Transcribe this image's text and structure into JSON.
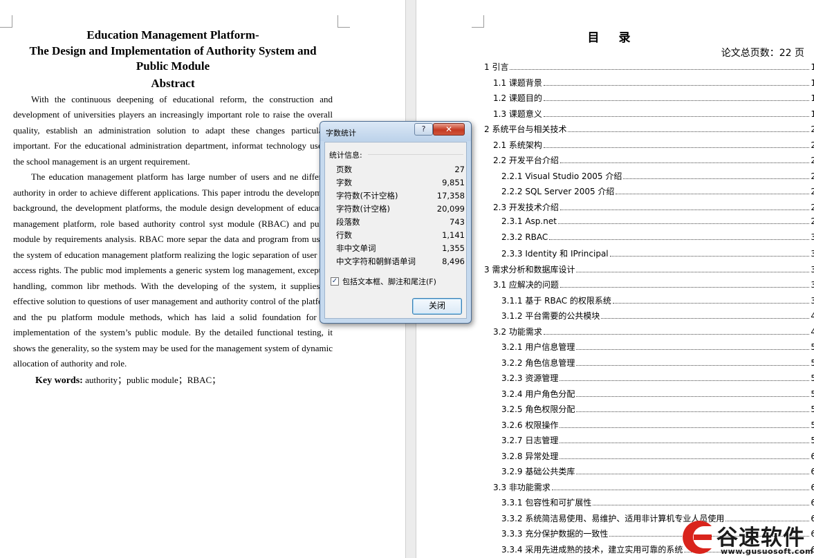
{
  "left_page": {
    "title_lines": [
      "Education Management Platform-",
      "The Design and Implementation of Authority System and",
      "Public Module"
    ],
    "abstract_heading": "Abstract",
    "para1": "With the continuous deepening of educational reform, the construction and development of universities players an increasingly important role to raise the overall quality, establish an administration solution to adapt these changes particularly important. For the educational administration department, informat technology use in the school management is an urgent requirement.",
    "para2": "The education management platform has large number of users and ne different authority in order to achieve different applications. This paper introdu the development background, the development platforms, the module design development of education management platform, role based authority control syst module (RBAC) and public module by requirements analysis. RBAC more separ the data and program from users, the system of education management platform realizing the logic separation of user and access rights. The public mod implements a generic system log management, exception handling, common libr methods. With the developing of the system, it supplies an effective solution to questions of user management and authority control of the platform and the pu platform module methods, which has laid a solid foundation for the implementation of the system’s public module. By the detailed functional testing, it shows the generality, so the system may be used for the management system of dynamic allocation of authority and role.",
    "keywords_label": "Key words:",
    "keywords_value": "authority；public module；RBAC；"
  },
  "right_page": {
    "toc_title": "目录",
    "total_pages": "论文总页数：22 页",
    "toc": [
      {
        "label": "1 引言",
        "page": "1",
        "level": 1
      },
      {
        "label": "1.1 课题背景",
        "page": "1",
        "level": 2
      },
      {
        "label": "1.2 课题目的",
        "page": "1",
        "level": 2
      },
      {
        "label": "1.3 课题意义",
        "page": "1",
        "level": 2
      },
      {
        "label": "2 系统平台与相关技术",
        "page": "2",
        "level": 1
      },
      {
        "label": "2.1 系统架构",
        "page": "2",
        "level": 2
      },
      {
        "label": "2.2 开发平台介绍",
        "page": "2",
        "level": 2
      },
      {
        "label": "2.2.1 Visual Studio 2005 介绍",
        "page": "2",
        "level": 3
      },
      {
        "label": "2.2.2 SQL Server 2005 介绍",
        "page": "2",
        "level": 3
      },
      {
        "label": "2.3 开发技术介绍",
        "page": "2",
        "level": 2
      },
      {
        "label": "2.3.1 Asp.net",
        "page": "2",
        "level": 3
      },
      {
        "label": "2.3.2 RBAC",
        "page": "3",
        "level": 3
      },
      {
        "label": "2.3.3 Identity 和 IPrincipal",
        "page": "3",
        "level": 3
      },
      {
        "label": "3 需求分析和数据库设计",
        "page": "3",
        "level": 1
      },
      {
        "label": "3.1 应解决的问题",
        "page": "3",
        "level": 2
      },
      {
        "label": "3.1.1 基于 RBAC 的权限系统",
        "page": "3",
        "level": 3
      },
      {
        "label": "3.1.2 平台需要的公共模块",
        "page": "4",
        "level": 3
      },
      {
        "label": "3.2 功能需求",
        "page": "4",
        "level": 2
      },
      {
        "label": "3.2.1 用户信息管理",
        "page": "5",
        "level": 3
      },
      {
        "label": "3.2.2 角色信息管理",
        "page": "5",
        "level": 3
      },
      {
        "label": "3.2.3 资源管理",
        "page": "5",
        "level": 3
      },
      {
        "label": "3.2.4 用户角色分配",
        "page": "5",
        "level": 3
      },
      {
        "label": "3.2.5 角色权限分配",
        "page": "5",
        "level": 3
      },
      {
        "label": "3.2.6 权限操作",
        "page": "5",
        "level": 3
      },
      {
        "label": "3.2.7 日志管理",
        "page": "5",
        "level": 3
      },
      {
        "label": "3.2.8 异常处理",
        "page": "6",
        "level": 3
      },
      {
        "label": "3.2.9 基础公共类库",
        "page": "6",
        "level": 3
      },
      {
        "label": "3.3 非功能需求",
        "page": "6",
        "level": 2
      },
      {
        "label": "3.3.1 包容性和可扩展性",
        "page": "6",
        "level": 3
      },
      {
        "label": "3.3.2 系统简洁易使用、易维护、适用非计算机专业人员使用",
        "page": "6",
        "level": 3
      },
      {
        "label": "3.3.3 充分保护数据的一致性",
        "page": "6",
        "level": 3
      },
      {
        "label": "3.3.4 采用先进成熟的技术，建立实用可靠的系统",
        "page": "6",
        "level": 3
      }
    ]
  },
  "dialog": {
    "title": "字数统计",
    "help_label": "?",
    "close_glyph": "✕",
    "section_label": "统计信息:",
    "stats": [
      {
        "label": "页数",
        "value": "27"
      },
      {
        "label": "字数",
        "value": "9,851"
      },
      {
        "label": "字符数(不计空格)",
        "value": "17,358"
      },
      {
        "label": "字符数(计空格)",
        "value": "20,099"
      },
      {
        "label": "段落数",
        "value": "743"
      },
      {
        "label": "行数",
        "value": "1,141"
      },
      {
        "label": "非中文单词",
        "value": "1,355"
      },
      {
        "label": "中文字符和朝鲜语单词",
        "value": "8,496"
      }
    ],
    "checkbox_label": "包括文本框、脚注和尾注(F)",
    "checkbox_checked": true,
    "close_button": "关闭"
  },
  "watermark": {
    "brand": "谷速软件",
    "url": "www.gusuosoft.com",
    "color": "#d9241c"
  }
}
